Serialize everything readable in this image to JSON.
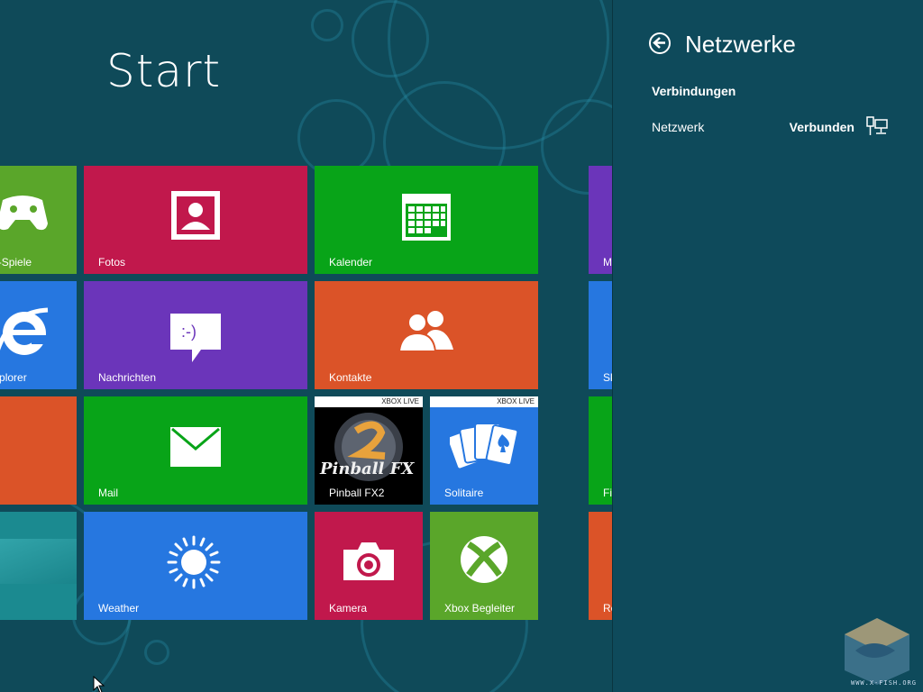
{
  "start": {
    "title": "Start"
  },
  "tiles": {
    "xbox_live_games": {
      "label": "Xbox LIVE-Spiele",
      "icon": "controller-icon",
      "color": "#5aa62a"
    },
    "photos": {
      "label": "Fotos",
      "icon": "photo-icon",
      "color": "#c1184c"
    },
    "calendar": {
      "label": "Kalender",
      "icon": "calendar-icon",
      "color": "#08a418"
    },
    "ie": {
      "label": "Internet Explorer",
      "icon": "ie-icon",
      "color": "#2677e0"
    },
    "messages": {
      "label": "Nachrichten",
      "icon": "chat-icon",
      "color": "#6b35ba"
    },
    "contacts": {
      "label": "Kontakte",
      "icon": "people-icon",
      "color": "#db5328"
    },
    "orange": {
      "label": "",
      "color": "#db5328"
    },
    "mail": {
      "label": "Mail",
      "icon": "envelope-icon",
      "color": "#08a418"
    },
    "pinball": {
      "label": "Pinball FX2",
      "badge": "XBOX LIVE",
      "logo": "Pinball FX",
      "color": "#000000"
    },
    "solitaire": {
      "label": "Solitaire",
      "badge": "XBOX LIVE",
      "icon": "cards-icon",
      "color": "#2677e0"
    },
    "desktop": {
      "label": "",
      "color": "#1b8a90"
    },
    "weather": {
      "label": "Weather",
      "icon": "sun-icon",
      "color": "#2677e0"
    },
    "camera": {
      "label": "Kamera",
      "icon": "camera-icon",
      "color": "#c1184c"
    },
    "xbox_companion": {
      "label": "Xbox Begleiter",
      "icon": "xbox-icon",
      "color": "#5aa62a"
    },
    "right_col": [
      {
        "label": "M",
        "color": "#6b35ba"
      },
      {
        "label": "Sk",
        "color": "#2677e0"
      },
      {
        "label": "Fi",
        "color": "#08a418"
      },
      {
        "label": "Re",
        "color": "#db5328"
      }
    ]
  },
  "pane": {
    "title": "Netzwerke",
    "back_icon": "back-arrow-icon",
    "section": "Verbindungen",
    "network_label": "Netzwerk",
    "network_status": "Verbunden",
    "network_icon": "wired-network-icon"
  },
  "watermark": {
    "text": "WWW.X-FISH.ORG"
  }
}
